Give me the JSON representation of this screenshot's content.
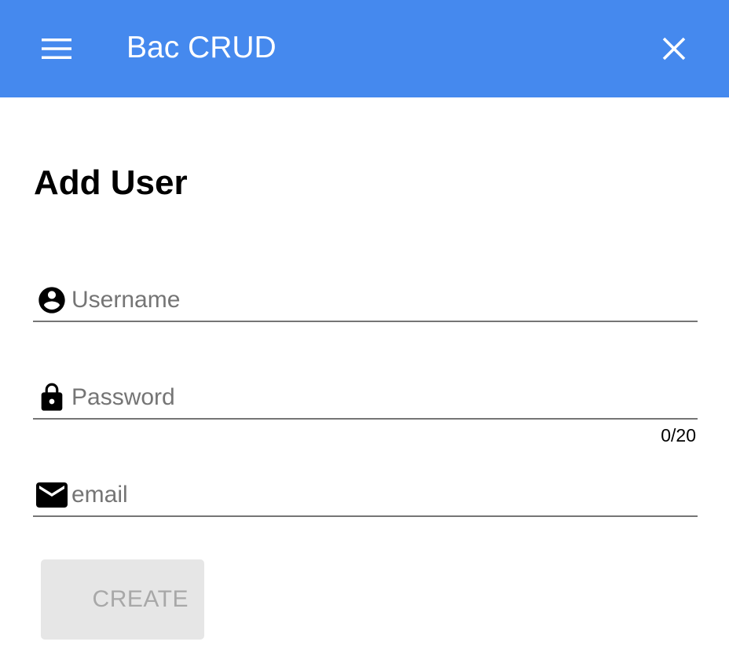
{
  "app_bar": {
    "title": "Bac CRUD",
    "background_color": "#4589EE",
    "menu_icon": "hamburger-menu-icon",
    "close_icon": "close-icon"
  },
  "page": {
    "title": "Add User"
  },
  "form": {
    "username": {
      "placeholder": "Username",
      "value": "",
      "icon": "account-circle-icon"
    },
    "password": {
      "placeholder": "Password",
      "value": "",
      "icon": "lock-icon",
      "counter": "0/20"
    },
    "email": {
      "placeholder": "email",
      "value": "",
      "icon": "mail-icon"
    },
    "create_label": "CREATE"
  }
}
